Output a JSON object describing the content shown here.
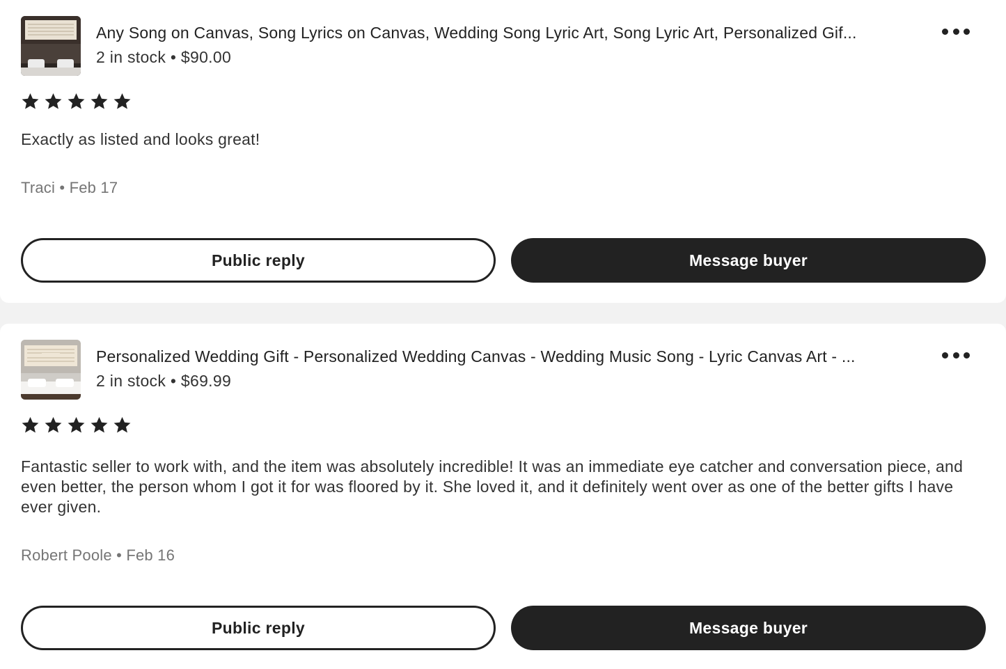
{
  "colors": {
    "background": "#f2f2f2",
    "card": "#ffffff",
    "primary": "#222222",
    "muted": "#757575"
  },
  "reviews": [
    {
      "listing_title": "Any Song on Canvas, Song Lyrics on Canvas, Wedding Song Lyric Art, Song Lyric Art, Personalized Gif...",
      "stock_price": "2 in stock • $90.00",
      "rating": 5,
      "text": "Exactly as listed and looks great!",
      "reviewer_date": "Traci • Feb 17",
      "public_reply_label": "Public reply",
      "message_buyer_label": "Message buyer",
      "thumbnail_icon": "listing-thumbnail-canvas",
      "more_icon": "more-options-icon"
    },
    {
      "listing_title": "Personalized Wedding Gift - Personalized Wedding Canvas - Wedding Music Song - Lyric Canvas Art - ...",
      "stock_price": "2 in stock • $69.99",
      "rating": 5,
      "text": "Fantastic seller to work with, and the item was absolutely incredible! It was an immediate eye catcher and conversation piece, and even better, the person whom I got it for was floored by it. She loved it, and it definitely went over as one of the better gifts I have ever given.",
      "reviewer_date": "Robert Poole • Feb 16",
      "public_reply_label": "Public reply",
      "message_buyer_label": "Message buyer",
      "thumbnail_icon": "listing-thumbnail-canvas",
      "more_icon": "more-options-icon"
    }
  ]
}
